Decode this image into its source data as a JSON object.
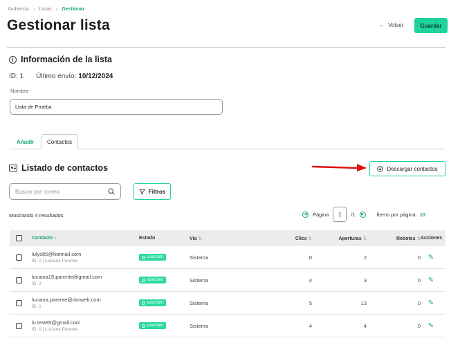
{
  "breadcrumb": {
    "items": [
      "Audiencia",
      "Listas"
    ],
    "current": "Gestionar"
  },
  "page_title": "Gestionar lista",
  "header": {
    "back_label": "Volver",
    "save_label": "Guardar"
  },
  "info": {
    "title": "Información de la lista",
    "id_text": "ID: 1",
    "last_send_label": "Último envío:",
    "last_send_value": "10/12/2024",
    "name_label": "Nombre",
    "name_value": "Lista de Prueba"
  },
  "tabs": [
    {
      "label": "Añadir",
      "active": false
    },
    {
      "label": "Contactos",
      "active": true
    }
  ],
  "contacts": {
    "title": "Listado de contactos",
    "download_label": "Descargar contactos",
    "search_placeholder": "Buscar por correo",
    "filters_label": "Filtros",
    "results_text": "Mostrando 4 resultados",
    "pagination": {
      "page_label": "Página",
      "page": "1",
      "total": "/1",
      "per_page_label": "Ítems por página:",
      "per_page": "10"
    },
    "columns": [
      "Contacto",
      "Estado",
      "Vía",
      "Clics",
      "Aperturas",
      "Rebotes",
      "Acciones"
    ],
    "rows": [
      {
        "email": "lulys85@hotmail.com",
        "sub": "ID: 2 | Luciana Parente",
        "status": "suscripto",
        "via": "Sistema",
        "clics": "0",
        "aperturas": "2",
        "rebotes": "0"
      },
      {
        "email": "luciana15.parente@gmail.com",
        "sub": "ID: 3",
        "status": "suscripto",
        "via": "Sistema",
        "clics": "4",
        "aperturas": "3",
        "rebotes": "0"
      },
      {
        "email": "luciana.parente@dorweb.com",
        "sub": "ID: 1",
        "status": "suscripto",
        "via": "Sistema",
        "clics": "5",
        "aperturas": "13",
        "rebotes": "0"
      },
      {
        "email": "lu.test85@gmail.com",
        "sub": "ID: 6 | Luciana Parente",
        "status": "suscripto",
        "via": "Sistema",
        "clics": "4",
        "aperturas": "4",
        "rebotes": "0"
      }
    ]
  },
  "colors": {
    "accent": "#1ed39a",
    "accent_text": "#1aa37a",
    "annotation_arrow": "#e01010"
  }
}
